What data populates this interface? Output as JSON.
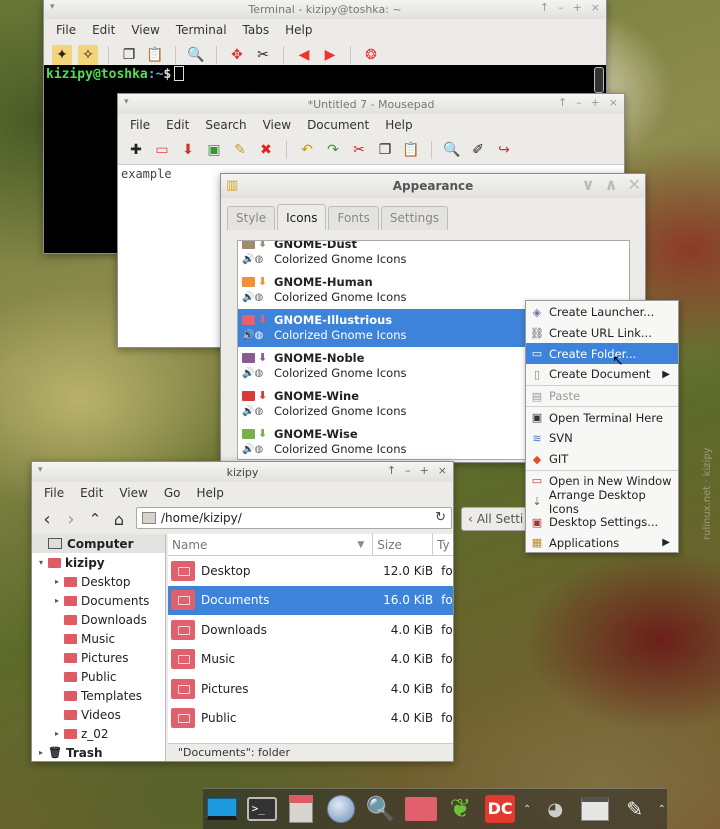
{
  "terminal": {
    "title": "Terminal - kizipy@toshka: ~",
    "menu": [
      "File",
      "Edit",
      "View",
      "Terminal",
      "Tabs",
      "Help"
    ],
    "prompt_user": "kizipy@toshka",
    "prompt_path": ":~",
    "prompt_sign": "$"
  },
  "mousepad": {
    "title": "*Untitled 7 - Mousepad",
    "menu": [
      "File",
      "Edit",
      "Search",
      "View",
      "Document",
      "Help"
    ],
    "content": "example"
  },
  "appearance": {
    "title": "Appearance",
    "tabs": [
      "Style",
      "Icons",
      "Fonts",
      "Settings"
    ],
    "themes": [
      {
        "name": "GNOME-Dust",
        "desc": "Colorized Gnome Icons",
        "color": "#a08a70"
      },
      {
        "name": "GNOME-Human",
        "desc": "Colorized Gnome Icons",
        "color": "#f0913a"
      },
      {
        "name": "GNOME-Illustrious",
        "desc": "Colorized Gnome Icons",
        "color": "#e8606e"
      },
      {
        "name": "GNOME-Noble",
        "desc": "Colorized Gnome Icons",
        "color": "#8a5a96"
      },
      {
        "name": "GNOME-Wine",
        "desc": "Colorized Gnome Icons",
        "color": "#d83a3a"
      },
      {
        "name": "GNOME-Wise",
        "desc": "Colorized Gnome Icons",
        "color": "#7ab04a"
      }
    ],
    "all_settings": "All Setti"
  },
  "context_menu": {
    "items": [
      {
        "label": "Create Launcher...",
        "icon": "launcher-icon"
      },
      {
        "label": "Create URL Link...",
        "icon": "url-link-icon"
      },
      {
        "label": "Create Folder...",
        "icon": "folder-icon"
      },
      {
        "label": "Create Document",
        "icon": "document-icon"
      },
      {
        "label": "Paste",
        "icon": "paste-icon"
      },
      {
        "label": "Open Terminal Here",
        "icon": "terminal-icon"
      },
      {
        "label": "SVN",
        "icon": "svn-icon"
      },
      {
        "label": "GIT",
        "icon": "git-icon"
      },
      {
        "label": "Open in New Window",
        "icon": "window-icon"
      },
      {
        "label": "Arrange Desktop Icons",
        "icon": "arrange-icon"
      },
      {
        "label": "Desktop Settings...",
        "icon": "desktop-settings-icon"
      },
      {
        "label": "Applications",
        "icon": "applications-icon"
      }
    ]
  },
  "filemgr": {
    "title": "kizipy",
    "menu": [
      "File",
      "Edit",
      "View",
      "Go",
      "Help"
    ],
    "path": "/home/kizipy/",
    "sidebar": [
      {
        "label": "Computer"
      },
      {
        "label": "kizipy"
      },
      {
        "label": "Desktop"
      },
      {
        "label": "Documents"
      },
      {
        "label": "Downloads"
      },
      {
        "label": "Music"
      },
      {
        "label": "Pictures"
      },
      {
        "label": "Public"
      },
      {
        "label": "Templates"
      },
      {
        "label": "Videos"
      },
      {
        "label": "z_02"
      },
      {
        "label": "Trash"
      }
    ],
    "columns": {
      "name": "Name",
      "size": "Size",
      "type": "Ty"
    },
    "rows": [
      {
        "name": "Desktop",
        "size": "12.0 KiB",
        "type": "fol"
      },
      {
        "name": "Documents",
        "size": "16.0 KiB",
        "type": "fol"
      },
      {
        "name": "Downloads",
        "size": "4.0 KiB",
        "type": "fol"
      },
      {
        "name": "Music",
        "size": "4.0 KiB",
        "type": "fol"
      },
      {
        "name": "Pictures",
        "size": "4.0 KiB",
        "type": "fol"
      },
      {
        "name": "Public",
        "size": "4.0 KiB",
        "type": "fol"
      }
    ],
    "status": "\"Documents\": folder"
  },
  "watermark": "rulinux.net · kizipy"
}
